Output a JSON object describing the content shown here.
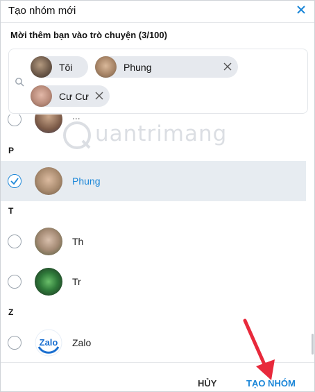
{
  "dialog": {
    "title": "Tạo nhóm mới",
    "subtitle": "Mời thêm bạn vào trò chuyện (3/100)"
  },
  "selected_chips": [
    {
      "label": "Tôi",
      "avatar_color": "#8b7766",
      "removable": false
    },
    {
      "label": "Phung",
      "avatar_color": "#b08f6e",
      "removable": true
    },
    {
      "label": "Cư Cư",
      "avatar_color": "#c09080",
      "removable": true
    }
  ],
  "sections": {
    "p": "P",
    "t": "T",
    "z": "Z"
  },
  "contacts": [
    {
      "name": "Phung",
      "checked": true,
      "avatar_color": "#b8987a"
    },
    {
      "name": "Th",
      "checked": false,
      "avatar_color": "#a9907a"
    },
    {
      "name": "Tr",
      "checked": false,
      "avatar_color": "#2f5a3a"
    },
    {
      "name": "Zalo",
      "checked": false,
      "avatar_color": "#ffffff"
    }
  ],
  "partial_top_name": "...",
  "footer": {
    "cancel_label": "HỦY",
    "create_label": "TẠO NHÓM"
  },
  "watermark": {
    "text": "uantrimang"
  },
  "colors": {
    "accent": "#1a86d8",
    "selected_row_bg": "#e7ecf1",
    "chip_bg": "#e6e9ee",
    "annotation_arrow": "#e8293b"
  }
}
